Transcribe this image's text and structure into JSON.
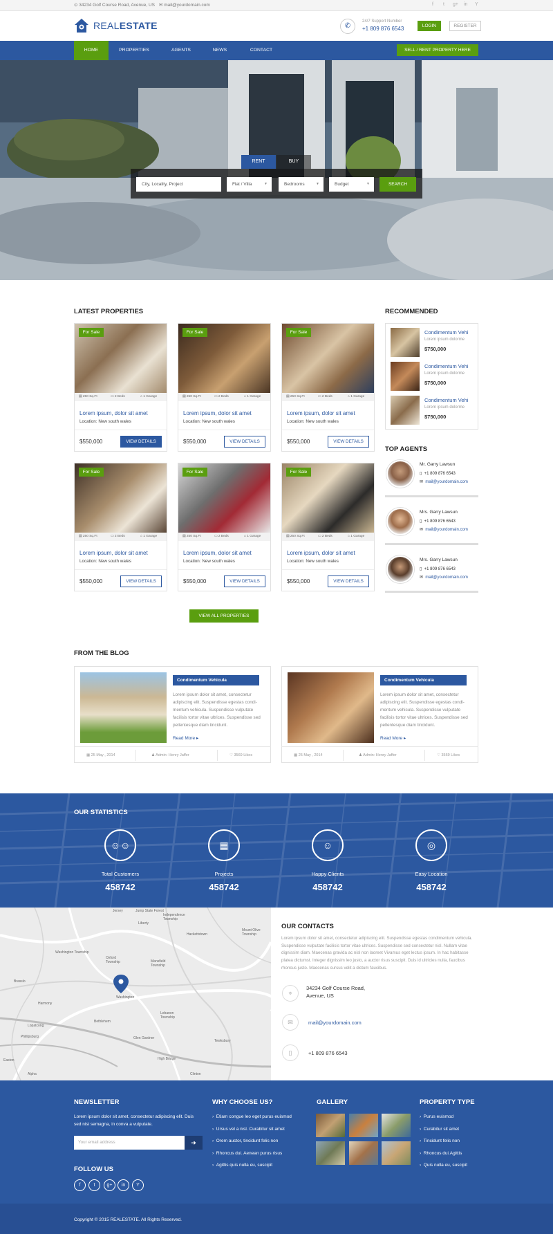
{
  "topbar": {
    "address": "34234 Golf Course Road, Avenue, US",
    "email": "mail@yourdomain.com",
    "social": [
      "f",
      "t",
      "g+",
      "in",
      "Y"
    ]
  },
  "header": {
    "logo_light": "REAL",
    "logo_bold": "ESTATE",
    "support_label": "24/7 Support Number",
    "support_phone": "+1 809 876 6543",
    "login": "LOGIN",
    "register": "REGISTER"
  },
  "nav": {
    "items": [
      "HOME",
      "PROPERTIES",
      "AGENTS",
      "NEWS",
      "CONTACT"
    ],
    "cta": "SELL / RENT PROPERTY HERE"
  },
  "search": {
    "tab_rent": "RENT",
    "tab_buy": "BUY",
    "location_placeholder": "City, Locality, Project",
    "type": "Flat / Villa",
    "bedrooms": "Bedrooms",
    "budget": "Budget",
    "button": "SEARCH"
  },
  "latest": {
    "title": "LATEST PROPERTIES",
    "properties": [
      {
        "badge": "For Sale",
        "area": "250 Sq.Ft",
        "beds": "2 Beds",
        "garage": "1 Garage",
        "title": "Lorem ipsum, dolor sit amet",
        "location_label": "Location:",
        "location": "New south wales",
        "price": "$550,000",
        "button": "VIEW DETAILS"
      },
      {
        "badge": "For Sale",
        "area": "250 Sq.Ft",
        "beds": "2 Beds",
        "garage": "1 Garage",
        "title": "Lorem ipsum, dolor sit amet",
        "location_label": "Location:",
        "location": "New south wales",
        "price": "$550,000",
        "button": "VIEW DETAILS"
      },
      {
        "badge": "For Sale",
        "area": "250 Sq.Ft",
        "beds": "2 Beds",
        "garage": "1 Garage",
        "title": "Lorem ipsum, dolor sit amet",
        "location_label": "Location:",
        "location": "New south wales",
        "price": "$550,000",
        "button": "VIEW DETAILS"
      },
      {
        "badge": "For Sale",
        "area": "250 Sq.Ft",
        "beds": "2 Beds",
        "garage": "1 Garage",
        "title": "Lorem ipsum, dolor sit amet",
        "location_label": "Location:",
        "location": "New south wales",
        "price": "$550,000",
        "button": "VIEW DETAILS"
      },
      {
        "badge": "For Sale",
        "area": "250 Sq.Ft",
        "beds": "2 Beds",
        "garage": "1 Garage",
        "title": "Lorem ipsum, dolor sit amet",
        "location_label": "Location:",
        "location": "New south wales",
        "price": "$550,000",
        "button": "VIEW DETAILS"
      },
      {
        "badge": "For Sale",
        "area": "250 Sq.Ft",
        "beds": "2 Beds",
        "garage": "1 Garage",
        "title": "Lorem ipsum, dolor sit amet",
        "location_label": "Location:",
        "location": "New south wales",
        "price": "$550,000",
        "button": "VIEW DETAILS"
      }
    ],
    "view_all": "VIEW ALL PROPERTIES"
  },
  "recommended": {
    "title": "RECOMMENDED",
    "items": [
      {
        "title": "Condimentum Vehi",
        "sub": "Lorem ipsum dolorme",
        "price": "$750,000"
      },
      {
        "title": "Condimentum Vehi",
        "sub": "Lorem ipsum dolorme",
        "price": "$750,000"
      },
      {
        "title": "Condimentum Vehi",
        "sub": "Lorem ipsum dolorme",
        "price": "$750,000"
      }
    ]
  },
  "agents": {
    "title": "TOP AGENTS",
    "items": [
      {
        "name": "Mr. Garry Lawsun",
        "phone": "+1 809 876 6543",
        "email": "mail@yourdomain.com"
      },
      {
        "name": "Mrs. Garry Lawsun",
        "phone": "+1 809 876 6543",
        "email": "mail@yourdomain.com"
      },
      {
        "name": "Mrs. Garry Lawsun",
        "phone": "+1 809 876 6543",
        "email": "mail@yourdomain.com"
      }
    ]
  },
  "blog": {
    "title": "FROM THE BLOG",
    "posts": [
      {
        "title": "Condimentum Vehicula",
        "text": "Lorem ipsum dolor sit amet, consectetur adipiscing elit. Suspendisse egestas condi-mentum vehicula. Suspendisse vulputate facilisis tortor vitae ultrices. Suspendisse sed pellentesque diam tincidunt.",
        "more": "Read More",
        "date": "25 May , 2014",
        "author": "Admin: Henry Jaffer",
        "likes": "3569 Likes"
      },
      {
        "title": "Condimentum Vehicula",
        "text": "Lorem ipsum dolor sit amet, consectetur adipiscing elit. Suspendisse egestas condi-mentum vehicula. Suspendisse vulputate facilisis tortor vitae ultrices. Suspendisse sed pellentesque diam tincidunt.",
        "more": "Read More",
        "date": "25 May , 2014",
        "author": "Admin: Henry Jaffer",
        "likes": "3569 Likes"
      }
    ]
  },
  "stats": {
    "title": "OUR STATISTICS",
    "items": [
      {
        "label": "Total Customers",
        "value": "458742",
        "icon": "users-icon"
      },
      {
        "label": "Projects",
        "value": "458742",
        "icon": "building-icon"
      },
      {
        "label": "Happy Clients",
        "value": "458742",
        "icon": "smile-icon"
      },
      {
        "label": "Easy Location",
        "value": "458742",
        "icon": "compass-icon"
      }
    ]
  },
  "map": {
    "labels": [
      "Jersey",
      "Jump State Forest",
      "Independence Township",
      "Liberty",
      "Washington Township",
      "Hackettstown",
      "Mount Olive Township",
      "Oxford Township",
      "Mansfield Township",
      "Brasslo",
      "Washington",
      "Harmony",
      "Lopatcong",
      "Phillipsburg",
      "Bethlehem",
      "Lebanon Township",
      "Tewksbury",
      "Glen Gardner",
      "High Bridge",
      "Alpha",
      "Easton",
      "Clinton"
    ]
  },
  "contacts": {
    "title": "OUR CONTACTS",
    "text": "Lorem ipsum dolor sit amet, consectetur adipiscing elit. Suspendisse egestas condimentum vehicula. Suspendisse vulputate facilisis tortor vitae ultrices. Suspendisse sed consectetur nisl. Nullam vitae dignissim diam. Maecenas gravida ac nisl non laoreet Vivamus eget lectus ipsum. In hac habitasse platea dictumst. Integer dignissim leo justo, a auctor risus suscipit. Duis id ultricies nulla, faucibus rhoncus justo. Maecenas cursus velit a dictum faucibus.",
    "address_line1": "34234 Golf Course Road,",
    "address_line2": "Avenue, US",
    "email": "mail@yourdomain.com",
    "phone": "+1 809 876 6543"
  },
  "footer": {
    "newsletter_title": "NEWSLETTER",
    "newsletter_text": "Lorem ipsum dolor sit amet, consectetur adipiscing elit. Duis sed nisi semagna, in conva a vulputate.",
    "email_placeholder": "Your email address",
    "follow_title": "FOLLOW US",
    "social": [
      "f",
      "t",
      "g+",
      "in",
      "Y"
    ],
    "why_title": "WHY CHOOSE US?",
    "why_items": [
      "Etiam congue leo eget purus euismod",
      "Ursus vel a nisl. Curabitur sit amet",
      "Orem auctor, tincidunt felis non",
      "Rhoncus dui. Aenean purus risus",
      "Agittis quis nulla eu, suscipit"
    ],
    "gallery_title": "GALLERY",
    "type_title": "PROPERTY TYPE",
    "type_items": [
      "Purus euismod",
      "Curabitur sit amet",
      "Tincidunt felis non",
      "Rhoncus dui.Agittis",
      "Quis nulla eu, suscipit"
    ],
    "copyright": "Copyright © 2015 REALESTATE. All Rights Reserved."
  },
  "colors": {
    "primary": "#2c58a0",
    "accent": "#5a9e0f"
  }
}
